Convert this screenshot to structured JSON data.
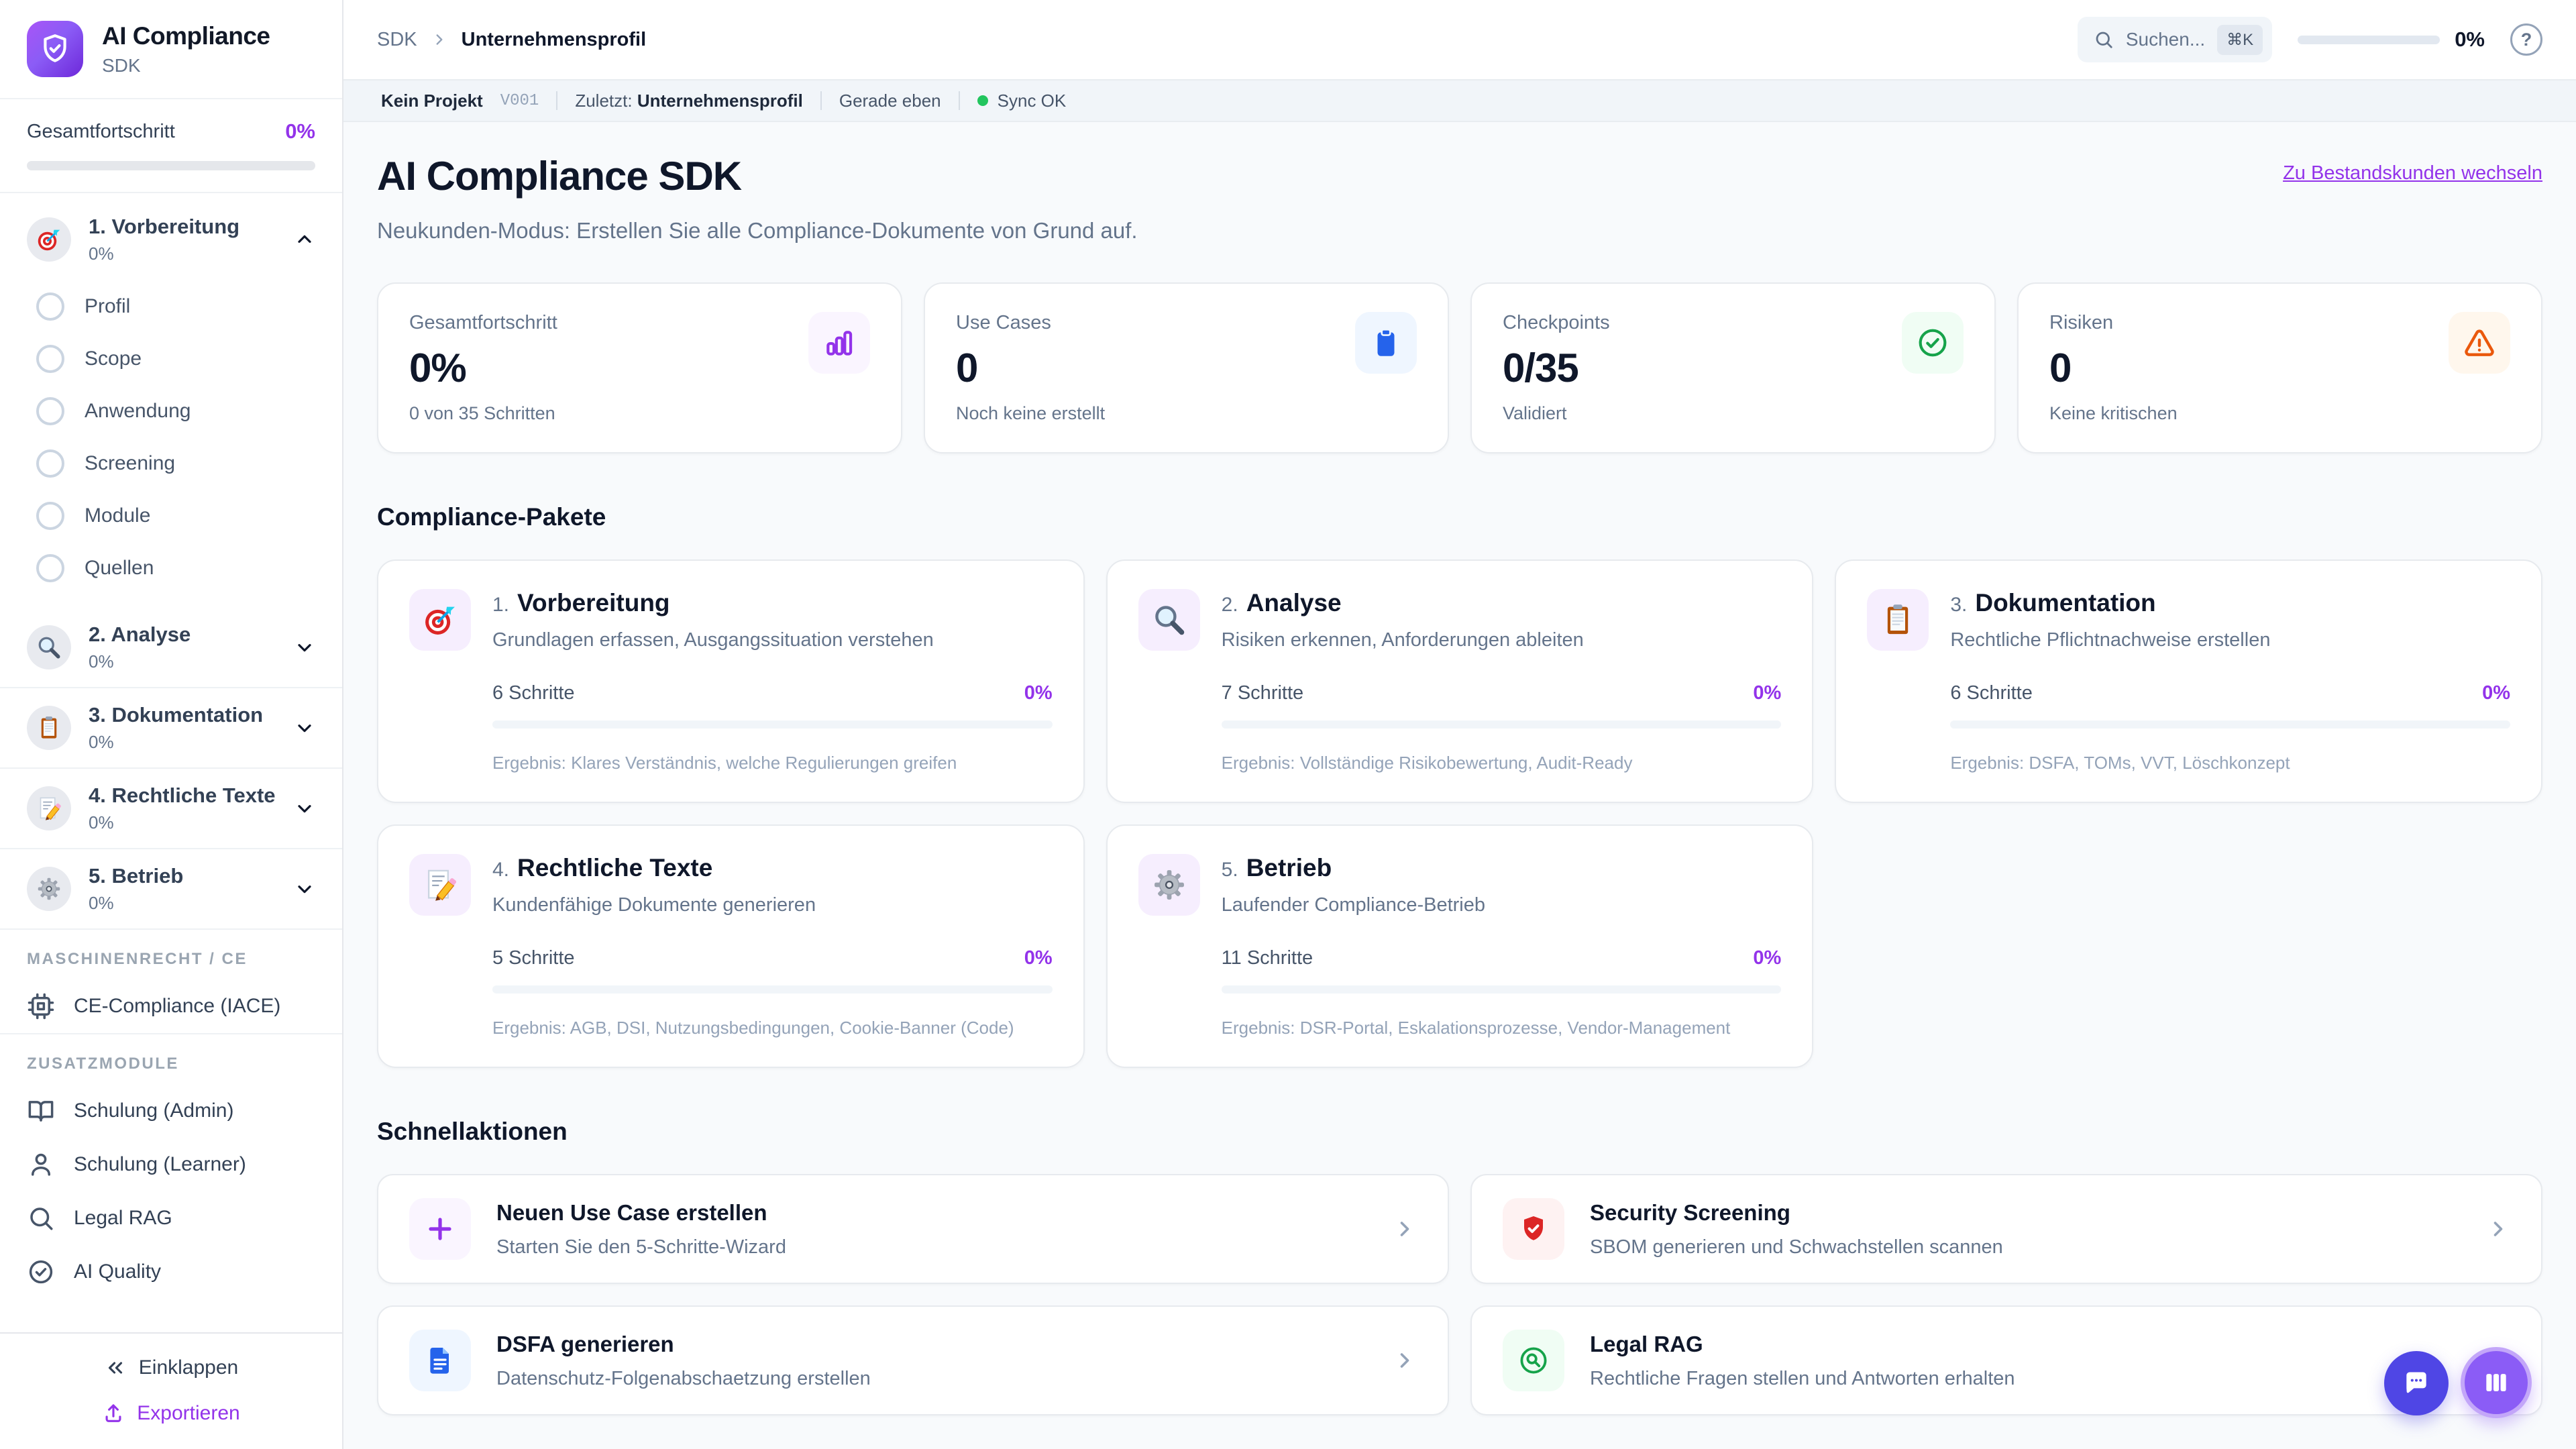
{
  "colors": {
    "accent_purple": "#9333ea",
    "logo_gradient_start": "#a855f7",
    "logo_gradient_end": "#6d28d9",
    "sync_green": "#22c55e",
    "stat_blue": "#2563eb",
    "stat_green": "#16a34a",
    "stat_orange": "#ea580c",
    "security_red": "#dc2626",
    "fab_indigo": "#4f46e5",
    "fab_purple": "#8b5cf6"
  },
  "sidebar": {
    "logo_icon": "shield-check-icon",
    "logo_title": "AI Compliance",
    "logo_subtitle": "SDK",
    "overall_label": "Gesamtfortschritt",
    "overall_value": "0%",
    "phases": [
      {
        "label": "1. Vorbereitung",
        "pct": "0%",
        "icon": "target-icon",
        "expanded": true,
        "children": [
          "Profil",
          "Scope",
          "Anwendung",
          "Screening",
          "Module",
          "Quellen"
        ]
      },
      {
        "label": "2. Analyse",
        "pct": "0%",
        "icon": "magnifier-icon",
        "expanded": false
      },
      {
        "label": "3. Dokumentation",
        "pct": "0%",
        "icon": "clipboard-icon",
        "expanded": false
      },
      {
        "label": "4. Rechtliche Texte",
        "pct": "0%",
        "icon": "memo-pencil-icon",
        "expanded": false
      },
      {
        "label": "5. Betrieb",
        "pct": "0%",
        "icon": "gear-icon",
        "expanded": false
      }
    ],
    "section_machinery": "MASCHINENRECHT / CE",
    "machinery_item": {
      "label": "CE-Compliance (IACE)",
      "icon": "cpu-icon"
    },
    "section_addons": "ZUSATZMODULE",
    "addons": [
      {
        "label": "Schulung (Admin)",
        "icon": "book-open-icon"
      },
      {
        "label": "Schulung (Learner)",
        "icon": "user-icon"
      },
      {
        "label": "Legal RAG",
        "icon": "search-icon"
      },
      {
        "label": "AI Quality",
        "icon": "check-circle-icon"
      }
    ],
    "collapse_label": "Einklappen",
    "export_label": "Exportieren"
  },
  "topbar": {
    "breadcrumb_root": "SDK",
    "breadcrumb_current": "Unternehmensprofil",
    "search_placeholder": "Suchen...",
    "search_kbd": "⌘K",
    "progress_value": "0%",
    "help_label": "?"
  },
  "statusbar": {
    "project": "Kein Projekt",
    "version": "V001",
    "last_label": "Zuletzt:",
    "last_value": "Unternehmensprofil",
    "time": "Gerade eben",
    "sync": "Sync OK"
  },
  "header": {
    "title": "AI Compliance SDK",
    "subtitle": "Neukunden-Modus: Erstellen Sie alle Compliance-Dokumente von Grund auf.",
    "switch_link": "Zu Bestandskunden wechseln"
  },
  "stats": [
    {
      "label": "Gesamtfortschritt",
      "value": "0%",
      "sub": "0 von 35 Schritten",
      "icon": "bar-chart-icon"
    },
    {
      "label": "Use Cases",
      "value": "0",
      "sub": "Noch keine erstellt",
      "icon": "clipboard-icon"
    },
    {
      "label": "Checkpoints",
      "value": "0/35",
      "sub": "Validiert",
      "icon": "check-circle-icon"
    },
    {
      "label": "Risiken",
      "value": "0",
      "sub": "Keine kritischen",
      "icon": "alert-triangle-icon"
    }
  ],
  "packages": {
    "section_title": "Compliance-Pakete",
    "cards": [
      {
        "num": "1.",
        "title": "Vorbereitung",
        "icon": "target-icon",
        "desc": "Grundlagen erfassen, Ausgangssituation verstehen",
        "steps": "6 Schritte",
        "pct": "0%",
        "result": "Ergebnis: Klares Verständnis, welche Regulierungen greifen"
      },
      {
        "num": "2.",
        "title": "Analyse",
        "icon": "magnifier-icon",
        "desc": "Risiken erkennen, Anforderungen ableiten",
        "steps": "7 Schritte",
        "pct": "0%",
        "result": "Ergebnis: Vollständige Risikobewertung, Audit-Ready"
      },
      {
        "num": "3.",
        "title": "Dokumentation",
        "icon": "clipboard-icon",
        "desc": "Rechtliche Pflichtnachweise erstellen",
        "steps": "6 Schritte",
        "pct": "0%",
        "result": "Ergebnis: DSFA, TOMs, VVT, Löschkonzept"
      },
      {
        "num": "4.",
        "title": "Rechtliche Texte",
        "icon": "memo-pencil-icon",
        "desc": "Kundenfähige Dokumente generieren",
        "steps": "5 Schritte",
        "pct": "0%",
        "result": "Ergebnis: AGB, DSI, Nutzungsbedingungen, Cookie-Banner (Code)"
      },
      {
        "num": "5.",
        "title": "Betrieb",
        "icon": "gear-icon",
        "desc": "Laufender Compliance-Betrieb",
        "steps": "11 Schritte",
        "pct": "0%",
        "result": "Ergebnis: DSR-Portal, Eskalationsprozesse, Vendor-Management"
      }
    ]
  },
  "quick": {
    "section_title": "Schnellaktionen",
    "cards": [
      {
        "title": "Neuen Use Case erstellen",
        "sub": "Starten Sie den 5-Schritte-Wizard",
        "icon": "plus-icon"
      },
      {
        "title": "Security Screening",
        "sub": "SBOM generieren und Schwachstellen scannen",
        "icon": "shield-check-icon"
      },
      {
        "title": "DSFA generieren",
        "sub": "Datenschutz-Folgenabschaetzung erstellen",
        "icon": "file-text-icon"
      },
      {
        "title": "Legal RAG",
        "sub": "Rechtliche Fragen stellen und Antworten erhalten",
        "icon": "search-circle-icon"
      }
    ]
  },
  "fabs": [
    {
      "icon": "chat-bubble-icon"
    },
    {
      "icon": "kanban-columns-icon"
    }
  ]
}
